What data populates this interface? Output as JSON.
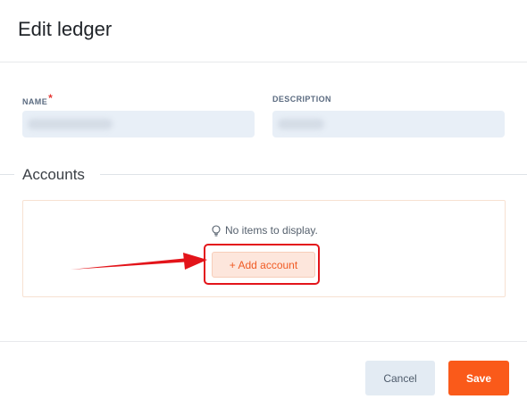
{
  "dialog": {
    "title": "Edit ledger"
  },
  "form": {
    "name": {
      "label": "NAME",
      "required_mark": "*"
    },
    "description": {
      "label": "DESCRIPTION"
    }
  },
  "accounts": {
    "heading": "Accounts",
    "empty_message": "No items to display.",
    "add_button_label": "+ Add account",
    "empty_icon": "lightbulb-icon"
  },
  "annotation": {
    "color": "#e3141a"
  },
  "footer": {
    "cancel_label": "Cancel",
    "save_label": "Save"
  },
  "colors": {
    "accent": "#fa5a1a",
    "field_bg": "#e8eff7",
    "cancel_bg": "#e3ebf3"
  }
}
